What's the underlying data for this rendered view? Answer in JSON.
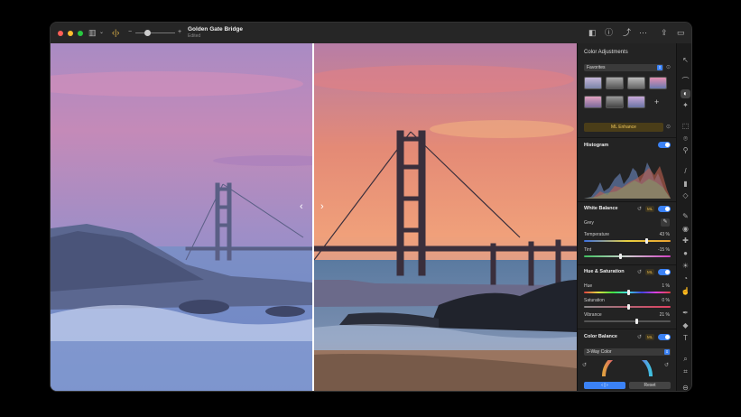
{
  "window": {
    "title": "Golden Gate Bridge",
    "subtitle": "Edited"
  },
  "colors": {
    "accent": "#3b82f6",
    "ml_gold": "#e8b94a",
    "close": "#ff5f57",
    "minimize": "#febc2e",
    "zoom": "#28c840"
  },
  "panel": {
    "title": "Color Adjustments",
    "preset_dropdown": "Favorites",
    "ml_enhance": "ML Enhance",
    "histogram": {
      "label": "Histogram",
      "enabled": true
    },
    "white_balance": {
      "label": "White Balance",
      "ml": "ML",
      "enabled": true,
      "grey_label": "Grey",
      "temperature": {
        "label": "Temperature",
        "value": "43 %",
        "level": 0.72
      },
      "tint": {
        "label": "Tint",
        "value": "-15 %",
        "level": 0.43
      }
    },
    "hue_saturation": {
      "label": "Hue & Saturation",
      "ml": "ML",
      "enabled": true,
      "hue": {
        "label": "Hue",
        "value": "1 %",
        "level": 0.5
      },
      "saturation": {
        "label": "Saturation",
        "value": "0 %",
        "level": 0.5
      },
      "vibrance": {
        "label": "Vibrance",
        "value": "21 %",
        "level": 0.6
      }
    },
    "color_balance": {
      "label": "Color Balance",
      "ml": "ML",
      "enabled": true,
      "mode": "3-Way Color"
    },
    "compare_button": "‹ | ›",
    "reset_button": "Reset"
  },
  "icons": {
    "sidebar": "sidebar-icon",
    "compare": "compare-icon",
    "info": "info-icon",
    "share": "share-icon",
    "more": "more-icon",
    "export": "export-icon",
    "panel_toggle": "panel-toggle-icon"
  }
}
